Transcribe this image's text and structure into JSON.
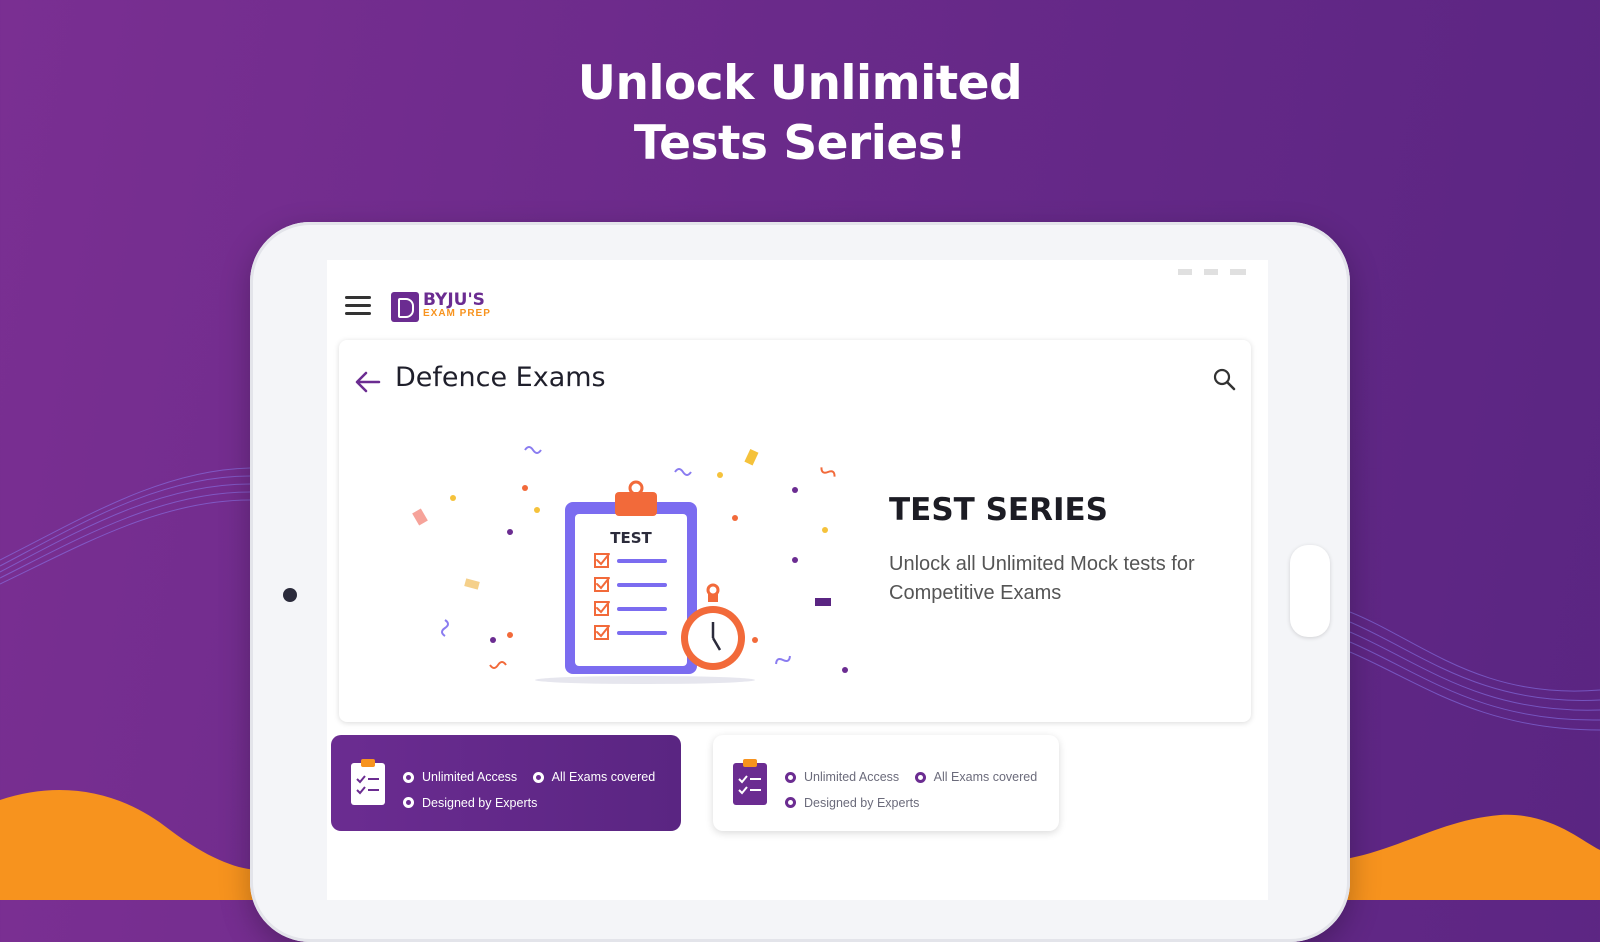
{
  "headline": {
    "line1": "Unlock Unlimited",
    "line2": "Tests Series!"
  },
  "app": {
    "brand": "BYJU'S",
    "brand_sub": "EXAM PREP",
    "page_title": "Defence Exams",
    "icons": {
      "menu": "hamburger-icon",
      "back": "back-arrow-icon",
      "search": "search-icon"
    }
  },
  "hero": {
    "clipboard_label": "TEST",
    "title": "TEST SERIES",
    "description": "Unlock all Unlimited Mock tests for Competitive Exams"
  },
  "plans": [
    {
      "state": "selected",
      "features": [
        "Unlimited Access",
        "All Exams covered",
        "Designed by Experts"
      ]
    },
    {
      "state": "unselected",
      "features": [
        "Unlimited Access",
        "All Exams covered",
        "Designed by Experts"
      ]
    }
  ],
  "colors": {
    "brand_purple": "#6b2c91",
    "accent_orange": "#f7931e",
    "background_purple": "#6a2a8a"
  }
}
